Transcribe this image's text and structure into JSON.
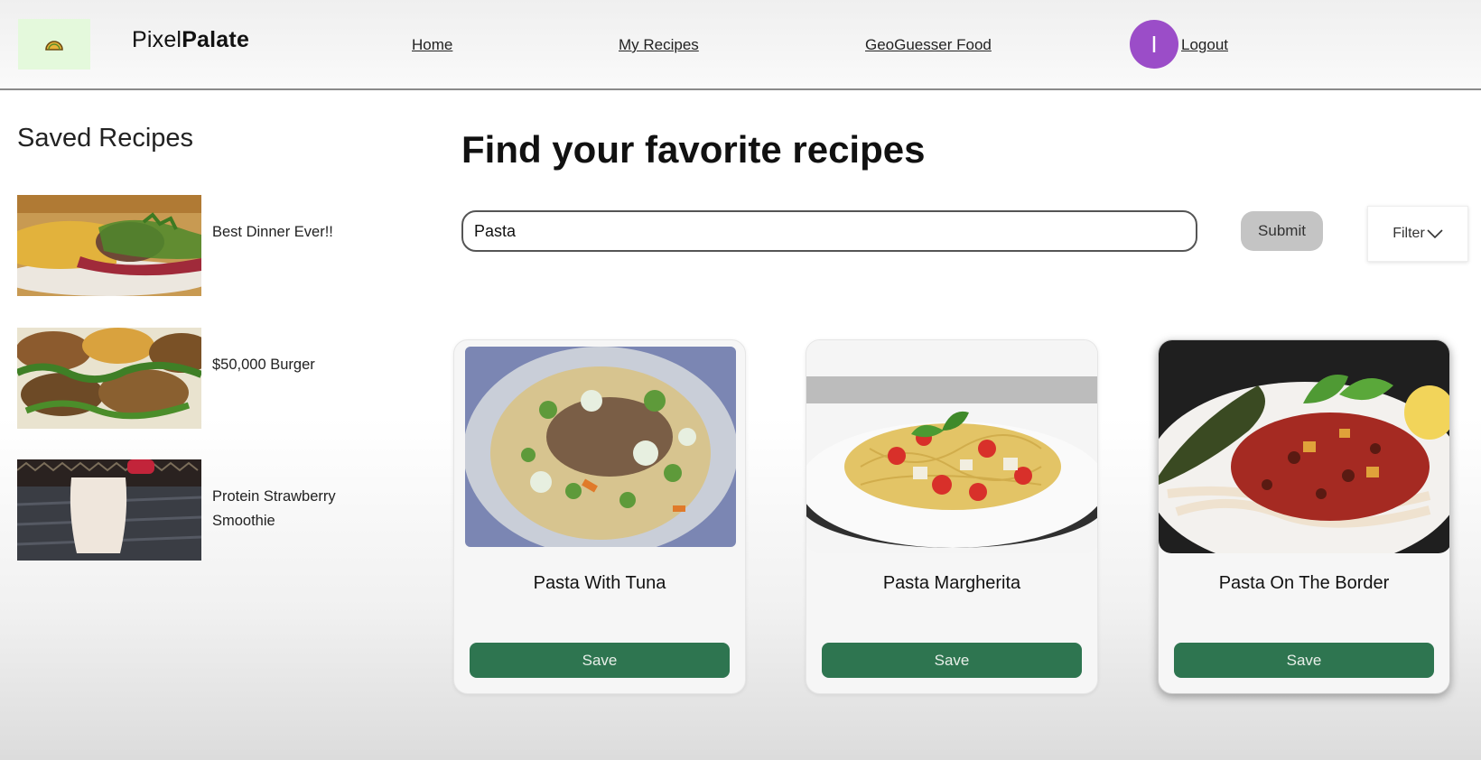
{
  "header": {
    "logo_icon": "taco-icon",
    "brand_regular": "Pixel",
    "brand_bold": "Palate",
    "nav": [
      {
        "label": "Home"
      },
      {
        "label": "My Recipes"
      },
      {
        "label": "GeoGuesser Food"
      }
    ],
    "avatar_initial": "I",
    "logout_label": "Logout",
    "avatar_color": "#9b4dc8"
  },
  "sidebar": {
    "title": "Saved Recipes",
    "items": [
      {
        "label": "Best Dinner Ever!!",
        "image": "burger-plate-photo"
      },
      {
        "label": "$50,000 Burger",
        "image": "sliders-photo"
      },
      {
        "label": "Protein Strawberry Smoothie",
        "image": "smoothie-photo"
      }
    ]
  },
  "main": {
    "title": "Find your favorite recipes",
    "search": {
      "value": "Pasta"
    },
    "submit_label": "Submit",
    "filter_label": "Filter",
    "results": [
      {
        "name": "Pasta With Tuna",
        "save_label": "Save",
        "image": "tuna-pasta-photo"
      },
      {
        "name": "Pasta Margherita",
        "save_label": "Save",
        "image": "margherita-pasta-photo"
      },
      {
        "name": "Pasta On The Border",
        "save_label": "Save",
        "image": "border-pasta-photo"
      }
    ]
  },
  "colors": {
    "save_green": "#2e7550",
    "logo_bg": "#e4f9dc",
    "submit_gray": "#c4c4c4"
  }
}
